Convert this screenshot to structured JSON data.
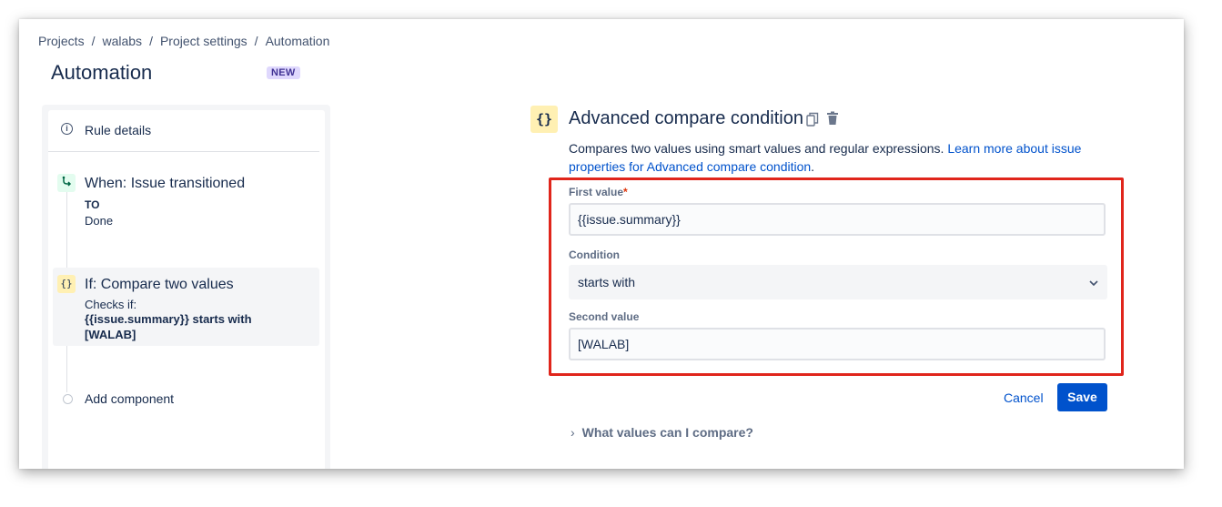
{
  "breadcrumbs": [
    "Projects",
    "walabs",
    "Project settings",
    "Automation"
  ],
  "breadcrumb_separator": "/",
  "page": {
    "title": "Automation",
    "badge": "NEW"
  },
  "sidebar": {
    "rule_details_label": "Rule details",
    "trigger": {
      "title": "When: Issue transitioned",
      "sub_label": "TO",
      "sub_value": "Done"
    },
    "condition": {
      "title": "If: Compare two values",
      "sub_label": "Checks if:",
      "detail": "{{issue.summary}} starts with [WALAB]"
    },
    "add_component_label": "Add component"
  },
  "config": {
    "icon_glyph": "{}",
    "title": "Advanced compare condition",
    "description_text": "Compares two values using smart values and regular expressions. ",
    "description_link": "Learn more about issue properties for Advanced compare condition",
    "description_end": ".",
    "first_value_label": "First value",
    "required_marker": "*",
    "first_value": "{{issue.summary}}",
    "condition_label": "Condition",
    "condition_value": "starts with",
    "second_value_label": "Second value",
    "second_value": "[WALAB]",
    "cancel_label": "Cancel",
    "save_label": "Save",
    "help_toggle_label": "What values can I compare?"
  },
  "colors": {
    "highlight": "#e0251b",
    "primary": "#0052cc",
    "badge_bg": "#dfd8fd"
  }
}
